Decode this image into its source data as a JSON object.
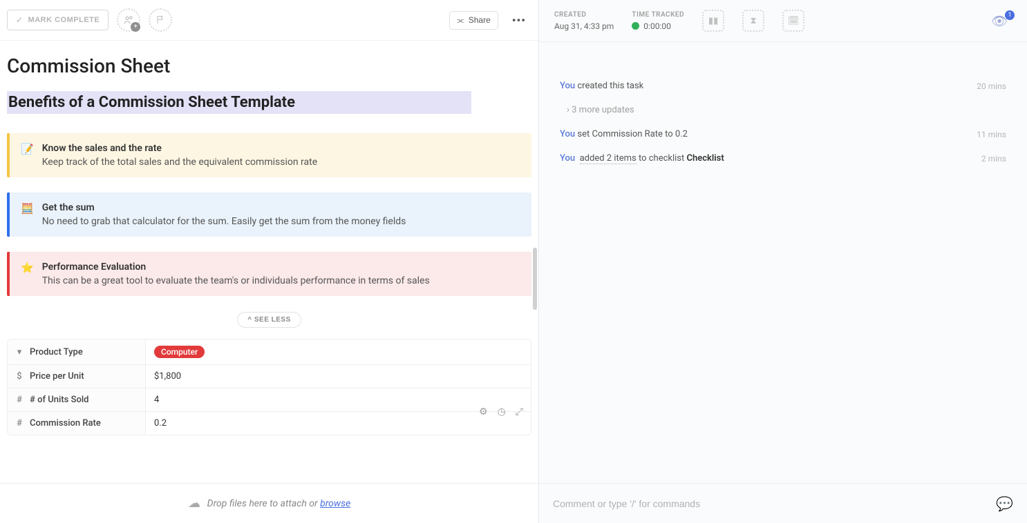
{
  "left_header": {
    "mark_complete": "MARK COMPLETE",
    "share": "Share"
  },
  "title": "Commission Sheet",
  "subtitle": "Benefits of a Commission Sheet Template",
  "callouts": [
    {
      "icon": "📝",
      "title": "Know the sales and the rate",
      "desc": "Keep track of the total sales and the equivalent commission rate"
    },
    {
      "icon": "🧮",
      "title": "Get the sum",
      "desc": "No need to grab that calculator for the sum. Easily get the sum from the money fields"
    },
    {
      "icon": "⭐",
      "title": "Performance Evaluation",
      "desc": "This can be a great tool to evaluate the team's or individuals performance in terms of sales"
    }
  ],
  "see_less": "^ SEE LESS",
  "fields": [
    {
      "icon": "▾",
      "label": "Product Type",
      "value": "Computer",
      "tag": true
    },
    {
      "icon": "$",
      "label": "Price per Unit",
      "value": "$1,800"
    },
    {
      "icon": "#",
      "label": "# of Units Sold",
      "value": "4"
    },
    {
      "icon": "#",
      "label": "Commission Rate",
      "value": "0.2"
    }
  ],
  "attach": {
    "text": "Drop files here to attach or ",
    "link": "browse"
  },
  "right_header": {
    "created_label": "CREATED",
    "created_value": "Aug 31, 4:33 pm",
    "time_label": "TIME TRACKED",
    "time_value": "0:00:00",
    "watch_count": "1"
  },
  "activity": {
    "row1": {
      "you": "You",
      "text": " created this task",
      "time": "20 mins"
    },
    "more": "3 more updates",
    "row2": {
      "you": "You",
      "text": " set Commission Rate to 0.2",
      "time": "11 mins"
    },
    "row3": {
      "you": "You",
      "added": "added 2 items",
      "to": " to checklist ",
      "checklist": "Checklist",
      "time": "2 mins"
    }
  },
  "comment_placeholder": "Comment or type '/' for commands"
}
